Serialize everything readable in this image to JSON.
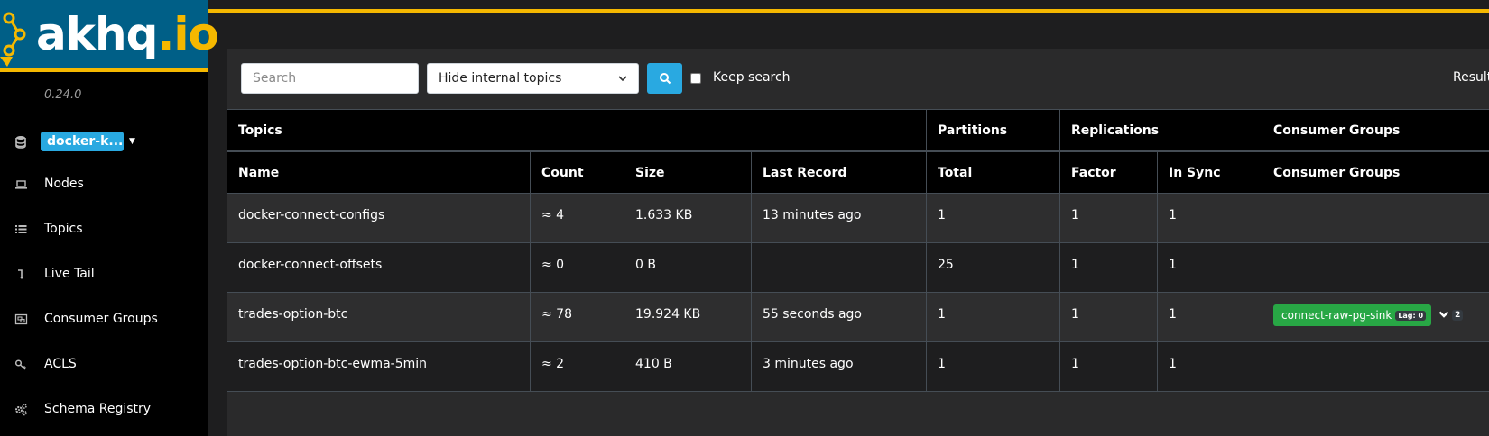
{
  "brand": {
    "name_main": "akhq",
    "name_suffix": ".io",
    "version": "0.24.0"
  },
  "cluster": {
    "name": "docker-k...",
    "icon": "database-icon"
  },
  "nav": [
    {
      "label": "Nodes",
      "icon": "laptop-icon"
    },
    {
      "label": "Topics",
      "icon": "list-icon"
    },
    {
      "label": "Live Tail",
      "icon": "level-down-icon"
    },
    {
      "label": "Consumer Groups",
      "icon": "object-group-icon"
    },
    {
      "label": "ACLS",
      "icon": "key-icon"
    },
    {
      "label": "Schema Registry",
      "icon": "cogs-icon"
    }
  ],
  "toolbar": {
    "search_placeholder": "Search",
    "filter_selected": "Hide internal topics",
    "keep_search_label": "Keep search",
    "results_label": "Result"
  },
  "table": {
    "group_headers": [
      "Topics",
      "Partitions",
      "Replications",
      "Consumer Groups"
    ],
    "column_headers": [
      "Name",
      "Count",
      "Size",
      "Last Record",
      "Total",
      "Factor",
      "In Sync",
      "Consumer Groups"
    ],
    "rows": [
      {
        "name": "docker-connect-configs",
        "count": "≈ 4",
        "size": "1.633 KB",
        "last_record": "13 minutes ago",
        "total": "1",
        "factor": "1",
        "in_sync": "1",
        "consumer_group": null
      },
      {
        "name": "docker-connect-offsets",
        "count": "≈ 0",
        "size": "0 B",
        "last_record": "",
        "total": "25",
        "factor": "1",
        "in_sync": "1",
        "consumer_group": null
      },
      {
        "name": "trades-option-btc",
        "count": "≈ 78",
        "size": "19.924 KB",
        "last_record": "55 seconds ago",
        "total": "1",
        "factor": "1",
        "in_sync": "1",
        "consumer_group": {
          "name": "connect-raw-pg-sink",
          "lag": "Lag: 0",
          "more": "2"
        }
      },
      {
        "name": "trades-option-btc-ewma-5min",
        "count": "≈ 2",
        "size": "410 B",
        "last_record": "3 minutes ago",
        "total": "1",
        "factor": "1",
        "in_sync": "1",
        "consumer_group": null
      }
    ]
  },
  "colors": {
    "accent": "#f5b800",
    "primary": "#29a9e1",
    "success": "#28a745",
    "logo_bg": "#005f87"
  }
}
